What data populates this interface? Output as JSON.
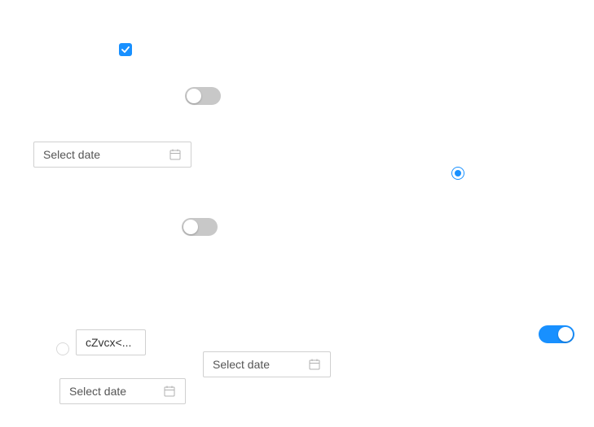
{
  "checkbox": {
    "checked": true,
    "color": "#1890ff"
  },
  "toggles": [
    {
      "on": false
    },
    {
      "on": false
    },
    {
      "on": true,
      "color": "#1890ff"
    }
  ],
  "date_pickers": [
    {
      "placeholder": "Select date",
      "icon": "calendar-icon"
    },
    {
      "placeholder": "Select date",
      "icon": "calendar-icon"
    },
    {
      "placeholder": "Select date",
      "icon": "calendar-icon"
    }
  ],
  "radios": [
    {
      "checked": true,
      "color": "#1890ff"
    },
    {
      "checked": false
    }
  ],
  "text_input": {
    "value": "cZvcx<..."
  }
}
